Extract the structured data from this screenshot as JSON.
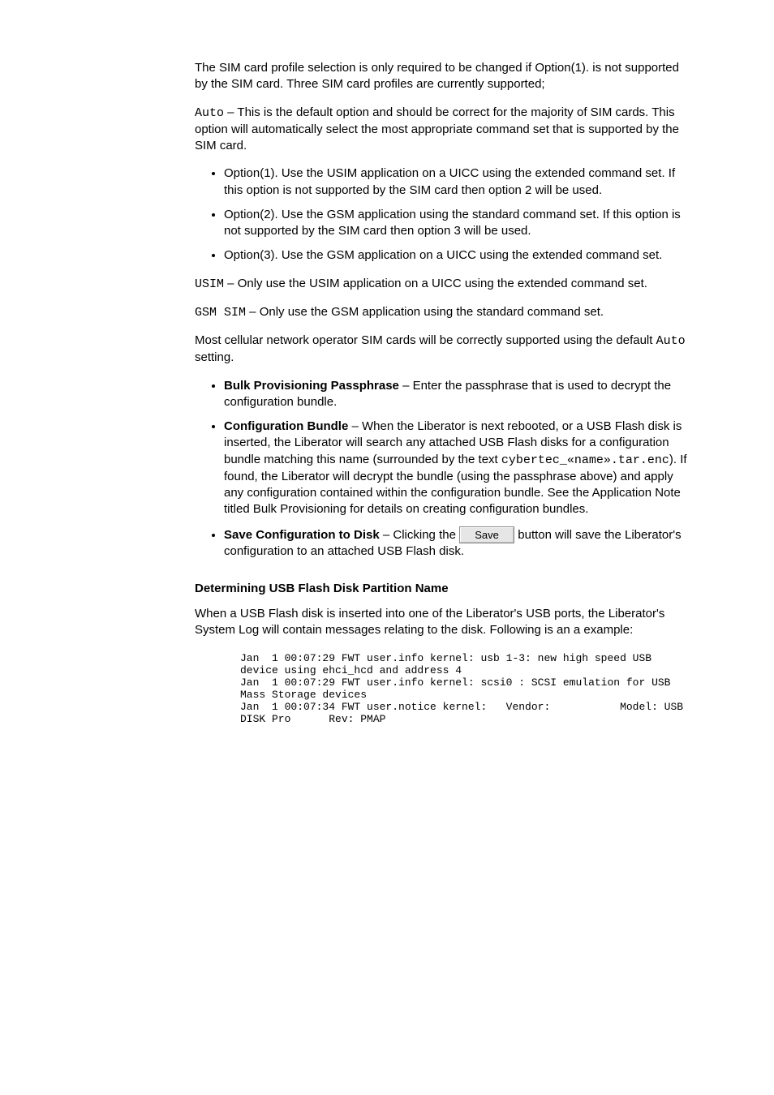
{
  "intro": {
    "p1": "The SIM card profile selection is only required to be changed if Option(1). is not supported by the SIM card. Three SIM card profiles are currently supported;",
    "option_auto_label": "Auto",
    "option_auto_desc": " – This is the default option and should be correct for the majority of SIM cards. This option will automatically select the most appropriate command set that is supported by the SIM card.",
    "bullets": [
      "Option(1). Use the USIM application on a UICC using the extended command set. If this option is not supported by the SIM card then option 2 will be used.",
      "Option(2). Use the GSM application using the standard command set. If this option is not supported by the SIM card then option 3 will be used.",
      "Option(3). Use the GSM application on a UICC using the extended command set."
    ],
    "usim_label": "USIM",
    "usim_desc": " – Only use the USIM application on a UICC using the extended command set.",
    "gsm_label": "GSM SIM",
    "gsm_desc": " – Only use the GSM application using the standard command set.",
    "note_para": "Most cellular network operator SIM cards will be correctly supported using the default ",
    "note_auto": "Auto",
    "note_tail": " setting."
  },
  "bulk": {
    "bullets": [
      {
        "label": "Bulk Provisioning Passphrase",
        "desc": " – Enter the passphrase that is used to decrypt the configuration bundle."
      },
      {
        "label": "Configuration Bundle",
        "desc_pre": " – When the Liberator is next rebooted, or a USB Flash disk is inserted, the Liberator will search any attached USB Flash disks for a configuration bundle matching this name (surrounded by the text ",
        "filename": "cybertec_«name».tar.enc",
        "desc_post": "). If found, the Liberator will decrypt the bundle (using the passphrase above) and apply any configuration contained within the configuration bundle. See the Application Note titled Bulk Provisioning for details on creating configuration bundles."
      },
      {
        "label": "Save Configuration to Disk",
        "desc_pre": " – Clicking the ",
        "btn": "Save",
        "desc_post": " button will save the Liberator's configuration to an attached USB Flash disk."
      }
    ]
  },
  "flash": {
    "heading": "Determining USB Flash Disk Partition Name",
    "p1": "When a USB Flash disk is inserted into one of the Liberator's USB ports, the Liberator's System Log will contain messages relating to the disk. Following is an a example:",
    "log": "Jan  1 00:07:29 FWT user.info kernel: usb 1-3: new high speed USB device using ehci_hcd and address 4\nJan  1 00:07:29 FWT user.info kernel: scsi0 : SCSI emulation for USB Mass Storage devices\nJan  1 00:07:34 FWT user.notice kernel:   Vendor:           Model: USB DISK Pro      Rev: PMAP"
  }
}
